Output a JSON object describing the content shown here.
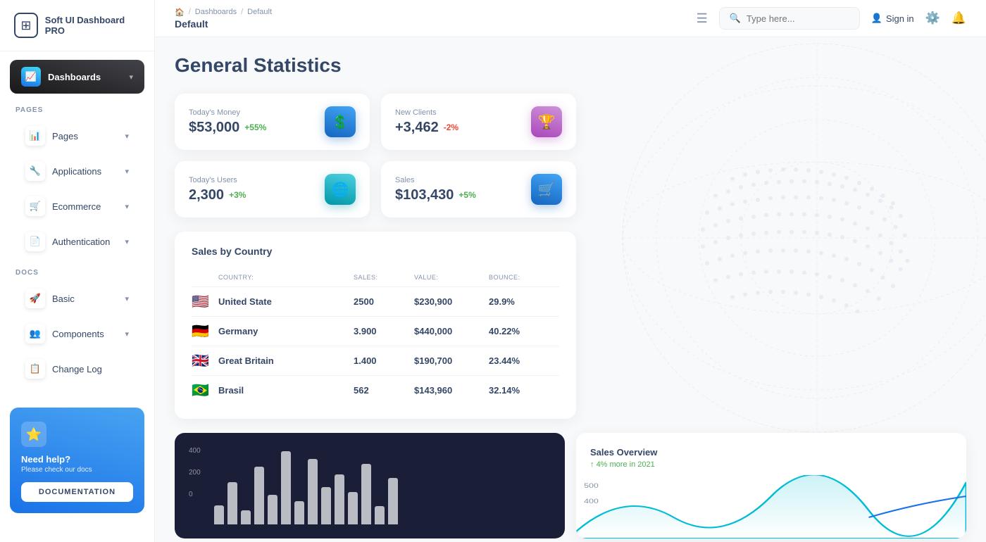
{
  "app": {
    "name": "Soft UI Dashboard PRO"
  },
  "sidebar": {
    "active_section": "Dashboards",
    "pages_label": "PAGES",
    "docs_label": "DOCS",
    "items_pages": [
      {
        "label": "Pages",
        "icon": "📊"
      },
      {
        "label": "Applications",
        "icon": "🔧"
      },
      {
        "label": "Ecommerce",
        "icon": "🛒"
      },
      {
        "label": "Authentication",
        "icon": "📄"
      }
    ],
    "items_docs": [
      {
        "label": "Basic",
        "icon": "🚀"
      },
      {
        "label": "Components",
        "icon": "👥"
      },
      {
        "label": "Change Log",
        "icon": "📋"
      }
    ],
    "help": {
      "title": "Need help?",
      "subtitle": "Please check our docs",
      "button": "DOCUMENTATION"
    }
  },
  "header": {
    "breadcrumb_home": "🏠",
    "breadcrumb_section": "Dashboards",
    "breadcrumb_page": "Default",
    "current_page": "Default",
    "search_placeholder": "Type here...",
    "sign_in": "Sign in"
  },
  "general_stats": {
    "title": "General Statistics",
    "cards": [
      {
        "label": "Today's Money",
        "value": "$53,000",
        "change": "+55%",
        "change_type": "positive",
        "icon": "💲",
        "icon_class": "blue2"
      },
      {
        "label": "New Clients",
        "value": "+3,462",
        "change": "-2%",
        "change_type": "negative",
        "icon": "🏆",
        "icon_class": "purple"
      },
      {
        "label": "Today's Users",
        "value": "2,300",
        "change": "+3%",
        "change_type": "positive",
        "icon": "🌐",
        "icon_class": "teal"
      },
      {
        "label": "Sales",
        "value": "$103,430",
        "change": "+5%",
        "change_type": "positive",
        "icon": "🛒",
        "icon_class": "blue2"
      }
    ]
  },
  "sales_by_country": {
    "title": "Sales by Country",
    "columns": [
      "Country:",
      "Sales:",
      "Value:",
      "Bounce:"
    ],
    "rows": [
      {
        "flag": "🇺🇸",
        "country": "United State",
        "sales": "2500",
        "value": "$230,900",
        "bounce": "29.9%"
      },
      {
        "flag": "🇩🇪",
        "country": "Germany",
        "sales": "3.900",
        "value": "$440,000",
        "bounce": "40.22%"
      },
      {
        "flag": "🇬🇧",
        "country": "Great Britain",
        "sales": "1.400",
        "value": "$190,700",
        "bounce": "23.44%"
      },
      {
        "flag": "🇧🇷",
        "country": "Brasil",
        "sales": "562",
        "value": "$143,960",
        "bounce": "32.14%"
      }
    ]
  },
  "bar_chart": {
    "y_labels": [
      "400",
      "200",
      "0"
    ],
    "bars": [
      20,
      45,
      15,
      60,
      30,
      80,
      25,
      70,
      40,
      55,
      35,
      65,
      20,
      50
    ]
  },
  "sales_overview": {
    "title": "Sales Overview",
    "subtitle": "4% more in 2021",
    "y_labels": [
      "500",
      "400"
    ]
  }
}
